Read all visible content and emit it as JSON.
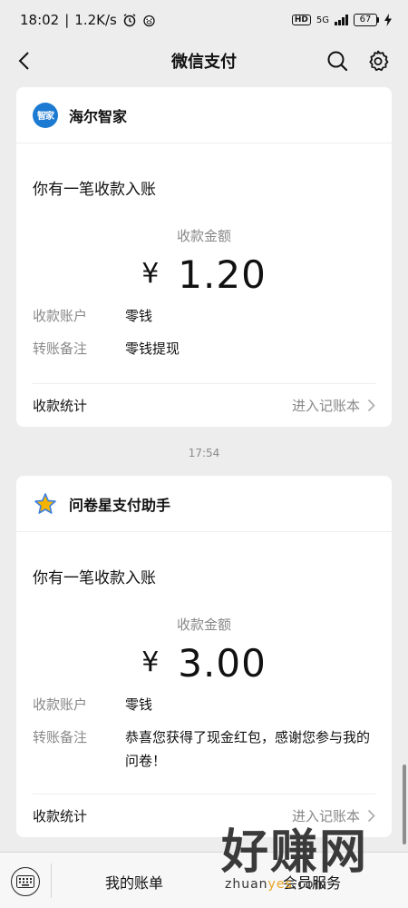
{
  "status_bar": {
    "time": "18:02",
    "net_speed": "1.2K/s",
    "hd": "HD",
    "network": "5G",
    "battery": "67"
  },
  "nav": {
    "title": "微信支付"
  },
  "cards": [
    {
      "app_name": "海尔智家",
      "logo_text": "智家",
      "notice": "你有一笔收款入账",
      "amount_label": "收款金额",
      "currency": "¥",
      "amount": "1.20",
      "rows": [
        {
          "key": "收款账户",
          "value": "零钱"
        },
        {
          "key": "转账备注",
          "value": "零钱提现"
        }
      ],
      "footer_left": "收款统计",
      "footer_right": "进入记账本"
    },
    {
      "app_name": "问卷星支付助手",
      "notice": "你有一笔收款入账",
      "amount_label": "收款金额",
      "currency": "¥",
      "amount": "3.00",
      "rows": [
        {
          "key": "收款账户",
          "value": "零钱"
        },
        {
          "key": "转账备注",
          "value": "恭喜您获得了现金红包，感谢您参与我的问卷！"
        }
      ],
      "footer_left": "收款统计",
      "footer_right": "进入记账本"
    }
  ],
  "timestamp": "17:54",
  "bottom_menu": {
    "item1": "我的账单",
    "item2": "会员服务"
  },
  "watermark": {
    "big": "好赚网",
    "small_pre": "zhuan",
    "small_hl": "yes",
    "small_post": ".com"
  },
  "colors": {
    "background": "#ededed",
    "card": "#ffffff",
    "muted_text": "#888888",
    "logo_blue": "#1c7ad2",
    "star_yellow": "#f5b400",
    "star_blue": "#3d7fe0"
  }
}
